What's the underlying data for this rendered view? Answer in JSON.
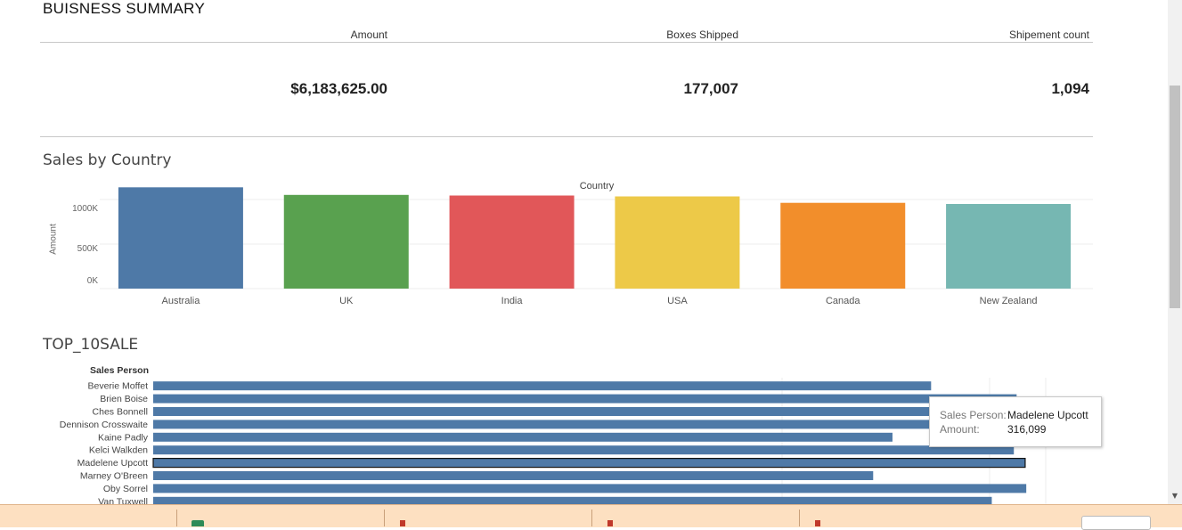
{
  "summary": {
    "title": "BUISNESS SUMMARY",
    "headers": [
      "Amount",
      "Boxes Shipped",
      "Shipement count"
    ],
    "values": [
      "$6,183,625.00",
      "177,007",
      "1,094"
    ]
  },
  "sales_by_country": {
    "title": "Sales by Country",
    "column_header": "Country",
    "ylabel": "Amount",
    "yticks": [
      "1000K",
      "500K",
      "0K"
    ]
  },
  "top10": {
    "title": "TOP_10SALE",
    "row_header": "Sales Person"
  },
  "tooltip": {
    "label1": "Sales Person:",
    "value1": "Madelene Upcott",
    "label2": "Amount:",
    "value2": "316,099"
  },
  "chart_data": [
    {
      "type": "bar",
      "title": "Sales by Country",
      "xlabel": "Country",
      "ylabel": "Amount",
      "categories": [
        "Australia",
        "UK",
        "India",
        "USA",
        "Canada",
        "New Zealand"
      ],
      "values": [
        1137000,
        1052000,
        1045000,
        1035000,
        963000,
        950000
      ],
      "colors": [
        "#4e79a7",
        "#59a14f",
        "#e15759",
        "#edc948",
        "#f28e2b",
        "#76b7b2"
      ],
      "ylim": [
        0,
        1100000
      ],
      "grid": true
    },
    {
      "type": "bar",
      "orientation": "horizontal",
      "title": "TOP_10SALE",
      "ylabel": "Sales Person",
      "categories": [
        "Beverie Moffet",
        "Brien Boise",
        "Ches Bonnell",
        "Dennison Crosswaite",
        "Kaine Padly",
        "Kelci Walkden",
        "Madelene Upcott",
        "Marney O'Breen",
        "Oby Sorrel",
        "Van Tuxwell"
      ],
      "values": [
        282000,
        313000,
        313000,
        304000,
        268000,
        312000,
        316099,
        261000,
        316500,
        304000
      ],
      "color": "#4e79a7",
      "highlighted": "Madelene Upcott",
      "xlim": [
        0,
        320000
      ]
    }
  ]
}
